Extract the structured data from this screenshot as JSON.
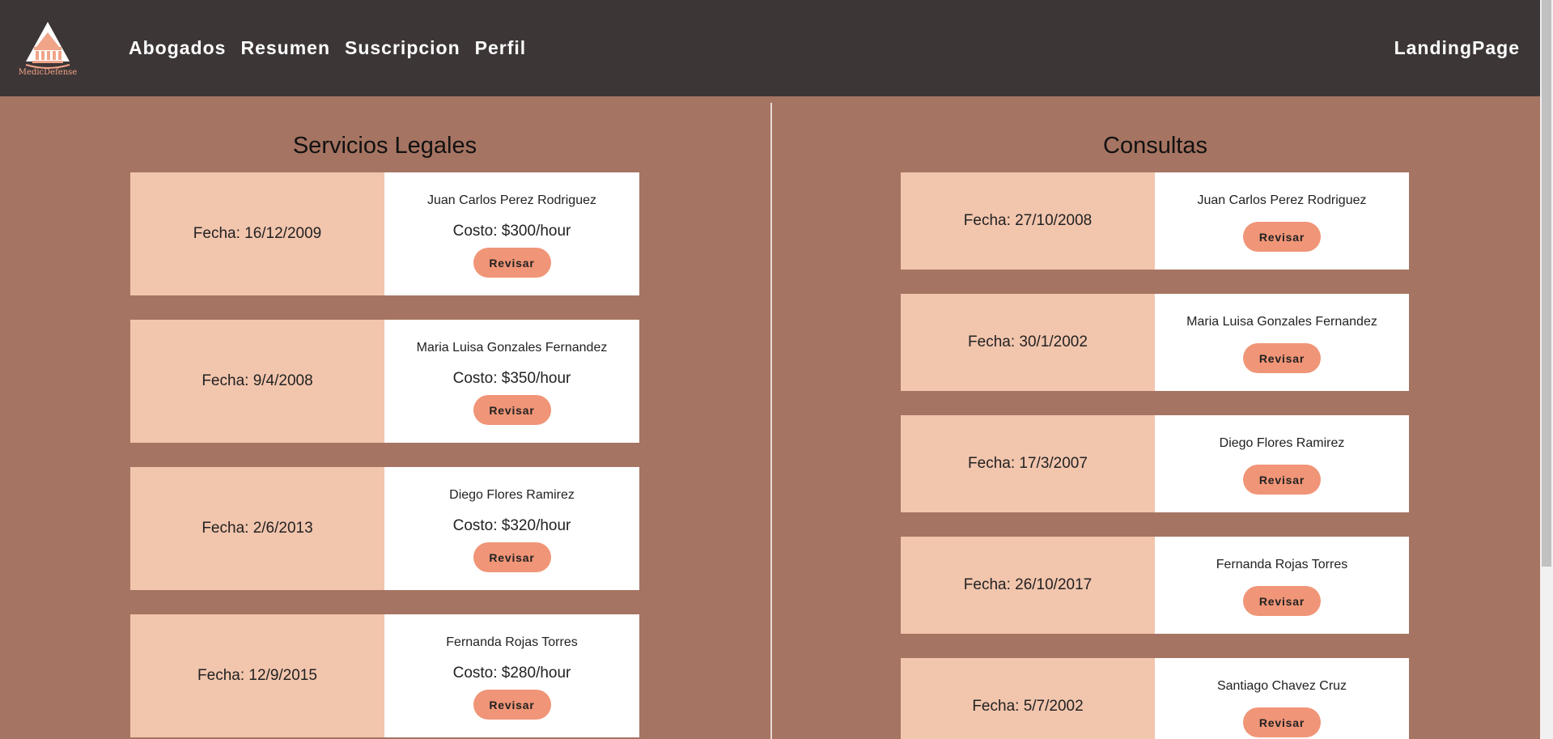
{
  "brand": {
    "logo_text": "MedicDefense"
  },
  "nav": {
    "items": [
      {
        "label": "Abogados"
      },
      {
        "label": "Resumen"
      },
      {
        "label": "Suscripcion"
      },
      {
        "label": "Perfil"
      }
    ],
    "right_link": "LandingPage"
  },
  "services": {
    "title": "Servicios Legales",
    "items": [
      {
        "date": "Fecha: 16/12/2009",
        "name": "Juan Carlos Perez Rodriguez",
        "cost": "Costo: $300/hour",
        "button": "Revisar"
      },
      {
        "date": "Fecha: 9/4/2008",
        "name": "Maria Luisa Gonzales Fernandez",
        "cost": "Costo: $350/hour",
        "button": "Revisar"
      },
      {
        "date": "Fecha: 2/6/2013",
        "name": "Diego Flores Ramirez",
        "cost": "Costo: $320/hour",
        "button": "Revisar"
      },
      {
        "date": "Fecha: 12/9/2015",
        "name": "Fernanda Rojas Torres",
        "cost": "Costo: $280/hour",
        "button": "Revisar"
      }
    ]
  },
  "consultations": {
    "title": "Consultas",
    "items": [
      {
        "date": "Fecha: 27/10/2008",
        "name": "Juan Carlos Perez Rodriguez",
        "button": "Revisar"
      },
      {
        "date": "Fecha: 30/1/2002",
        "name": "Maria Luisa Gonzales Fernandez",
        "button": "Revisar"
      },
      {
        "date": "Fecha: 17/3/2007",
        "name": "Diego Flores Ramirez",
        "button": "Revisar"
      },
      {
        "date": "Fecha: 26/10/2017",
        "name": "Fernanda Rojas Torres",
        "button": "Revisar"
      },
      {
        "date": "Fecha: 5/7/2002",
        "name": "Santiago Chavez Cruz",
        "button": "Revisar"
      }
    ]
  },
  "colors": {
    "header_bg": "#3d3637",
    "page_bg": "#a67462",
    "date_panel": "#f2c5ad",
    "button": "#f09577",
    "logo_accent": "#f0a488"
  }
}
